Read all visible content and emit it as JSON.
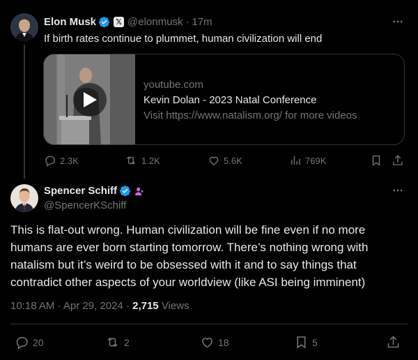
{
  "colors": {
    "background": "#000000",
    "text": "#e7e9ea",
    "muted": "#71767b",
    "verified_blue": "#1d9bf0",
    "border": "#2f3336",
    "affiliate_purple": "#c56bd6"
  },
  "original_post": {
    "author_name": "Elon Musk",
    "handle": "@elonmusk",
    "separator": "·",
    "time_ago": "17m",
    "text": "If birth rates continue to plummet, human civilization will end",
    "card": {
      "domain": "youtube.com",
      "title": "Kevin Dolan - 2023 Natal Conference",
      "description": "Visit https://www.natalism.org/ for more videos"
    },
    "actions": {
      "replies": "2.3K",
      "reposts": "1.2K",
      "likes": "5.6K",
      "views": "769K"
    },
    "icons": [
      "verified-badge-icon",
      "x-affiliate-icon",
      "more-icon",
      "reply-icon",
      "repost-icon",
      "like-icon",
      "views-icon",
      "bookmark-icon",
      "share-icon",
      "play-icon"
    ]
  },
  "reply_post": {
    "author_name": "Spencer Schiff",
    "handle": "@SpencerKSchiff",
    "text": "This is flat-out wrong. Human civilization will be fine even if no more humans are ever born starting tomorrow. There’s nothing wrong with natalism but it’s weird to be obsessed with it and to say things that contradict other aspects of your worldview (like ASI being imminent)",
    "timestamp": "10:18 AM · Apr 29, 2024 · ",
    "view_count": "2,715",
    "views_label": " Views",
    "actions": {
      "replies": "20",
      "reposts": "2",
      "likes": "18",
      "bookmarks": "5"
    }
  }
}
